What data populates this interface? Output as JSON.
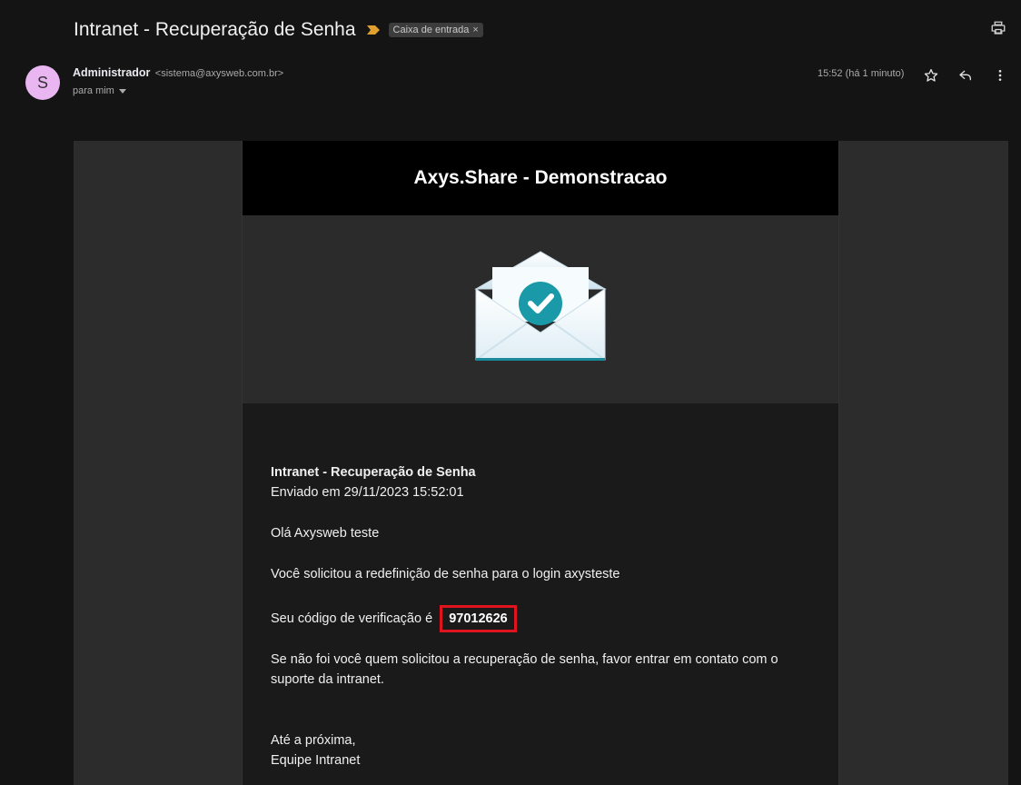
{
  "email": {
    "subject": "Intranet - Recuperação de Senha",
    "label": "Caixa de entrada",
    "label_remove": "×",
    "sender_initial": "S",
    "sender_name": "Administrador",
    "sender_email": "<sistema@axysweb.com.br>",
    "to": "para mim",
    "timestamp": "15:52 (há 1 minuto)"
  },
  "message": {
    "header_title": "Axys.Share - Demonstracao",
    "title": "Intranet - Recuperação de Senha",
    "sent": "Enviado em 29/11/2023 15:52:01",
    "greeting": "Olá Axysweb teste",
    "request": "Você solicitou a redefinição de senha para o login axysteste",
    "code_label": "Seu código de verificação é",
    "code": "97012626",
    "warning": "Se não foi você quem solicitou a recuperação de senha, favor entrar em contato com o suporte da intranet.",
    "closing": "Até a próxima,",
    "signature": "Equipe Intranet"
  },
  "icons": {
    "important": "important-marker-icon",
    "print": "print-icon",
    "star": "star-icon",
    "reply": "reply-icon",
    "more": "more-vert-icon",
    "envelope": "envelope-check-icon"
  },
  "colors": {
    "important_marker": "#e0a030",
    "avatar_bg": "#e9b6f2",
    "code_border": "#e0141e",
    "check_circle": "#1a9aa8"
  }
}
